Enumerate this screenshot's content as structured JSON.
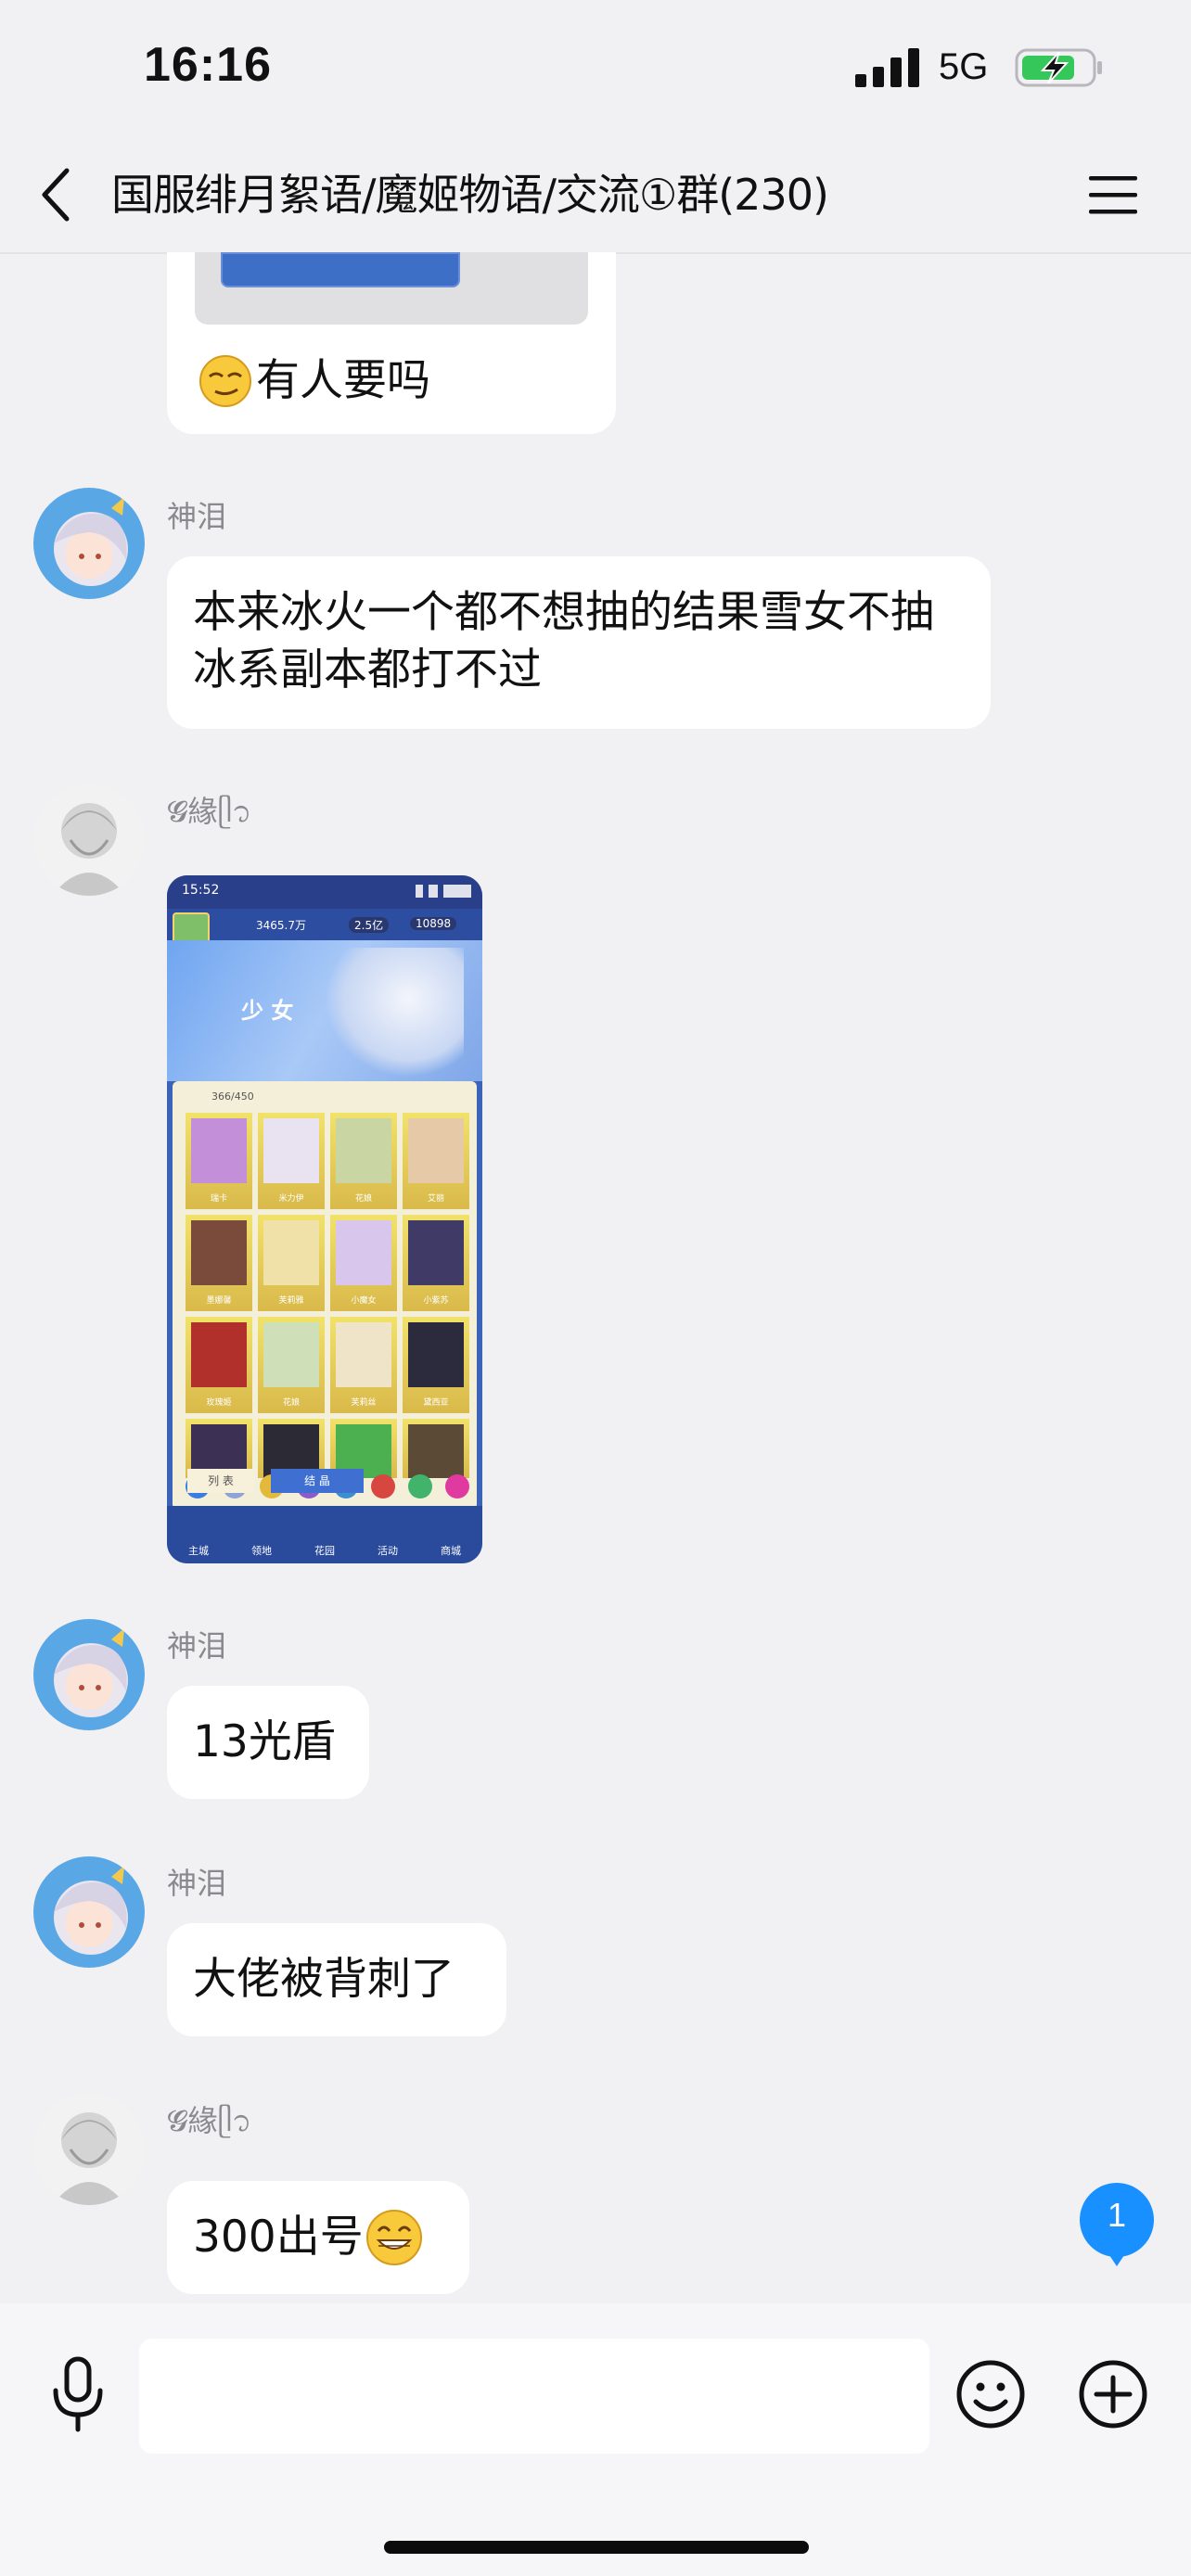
{
  "status": {
    "time": "16:16",
    "network": "5G"
  },
  "header": {
    "title": "国服绯月絮语/魔姬物语/交流①群(230)"
  },
  "messages": [
    {
      "text": "有人要吗"
    },
    {
      "sender": "神泪",
      "text": "本来冰火一个都不想抽的结果雪女不抽冰系副本都打不过"
    },
    {
      "sender": "𝓖緣ᥫ᭡",
      "image": "game-screenshot"
    },
    {
      "sender": "神泪",
      "text": "13光盾"
    },
    {
      "sender": "神泪",
      "text": "大佬被背刺了"
    },
    {
      "sender": "𝓖緣ᥫ᭡",
      "text": "300出号"
    }
  ],
  "game_screen": {
    "time": "15:52",
    "stat1": "3465.7万",
    "stat2": "2.5亿",
    "stat3": "10898",
    "banner": "少 女",
    "count": "366/450",
    "cards": [
      "瑞卡",
      "米力伊",
      "花娘",
      "艾丽",
      "墨娜馨",
      "芙莉雅",
      "小魔女",
      "小紫苏",
      "玫瑰姬",
      "花娘",
      "芙莉丝",
      "黛西亚"
    ],
    "tab_list": "列 表",
    "tab_crystal": "结 晶",
    "bottom_tabs": [
      "主城",
      "领地",
      "花园",
      "活动",
      "商城"
    ]
  },
  "unread_count": "1",
  "input": {
    "placeholder": ""
  },
  "colors": {
    "accent": "#1890ff",
    "background": "#f1f1f3",
    "bubble": "#ffffff"
  }
}
